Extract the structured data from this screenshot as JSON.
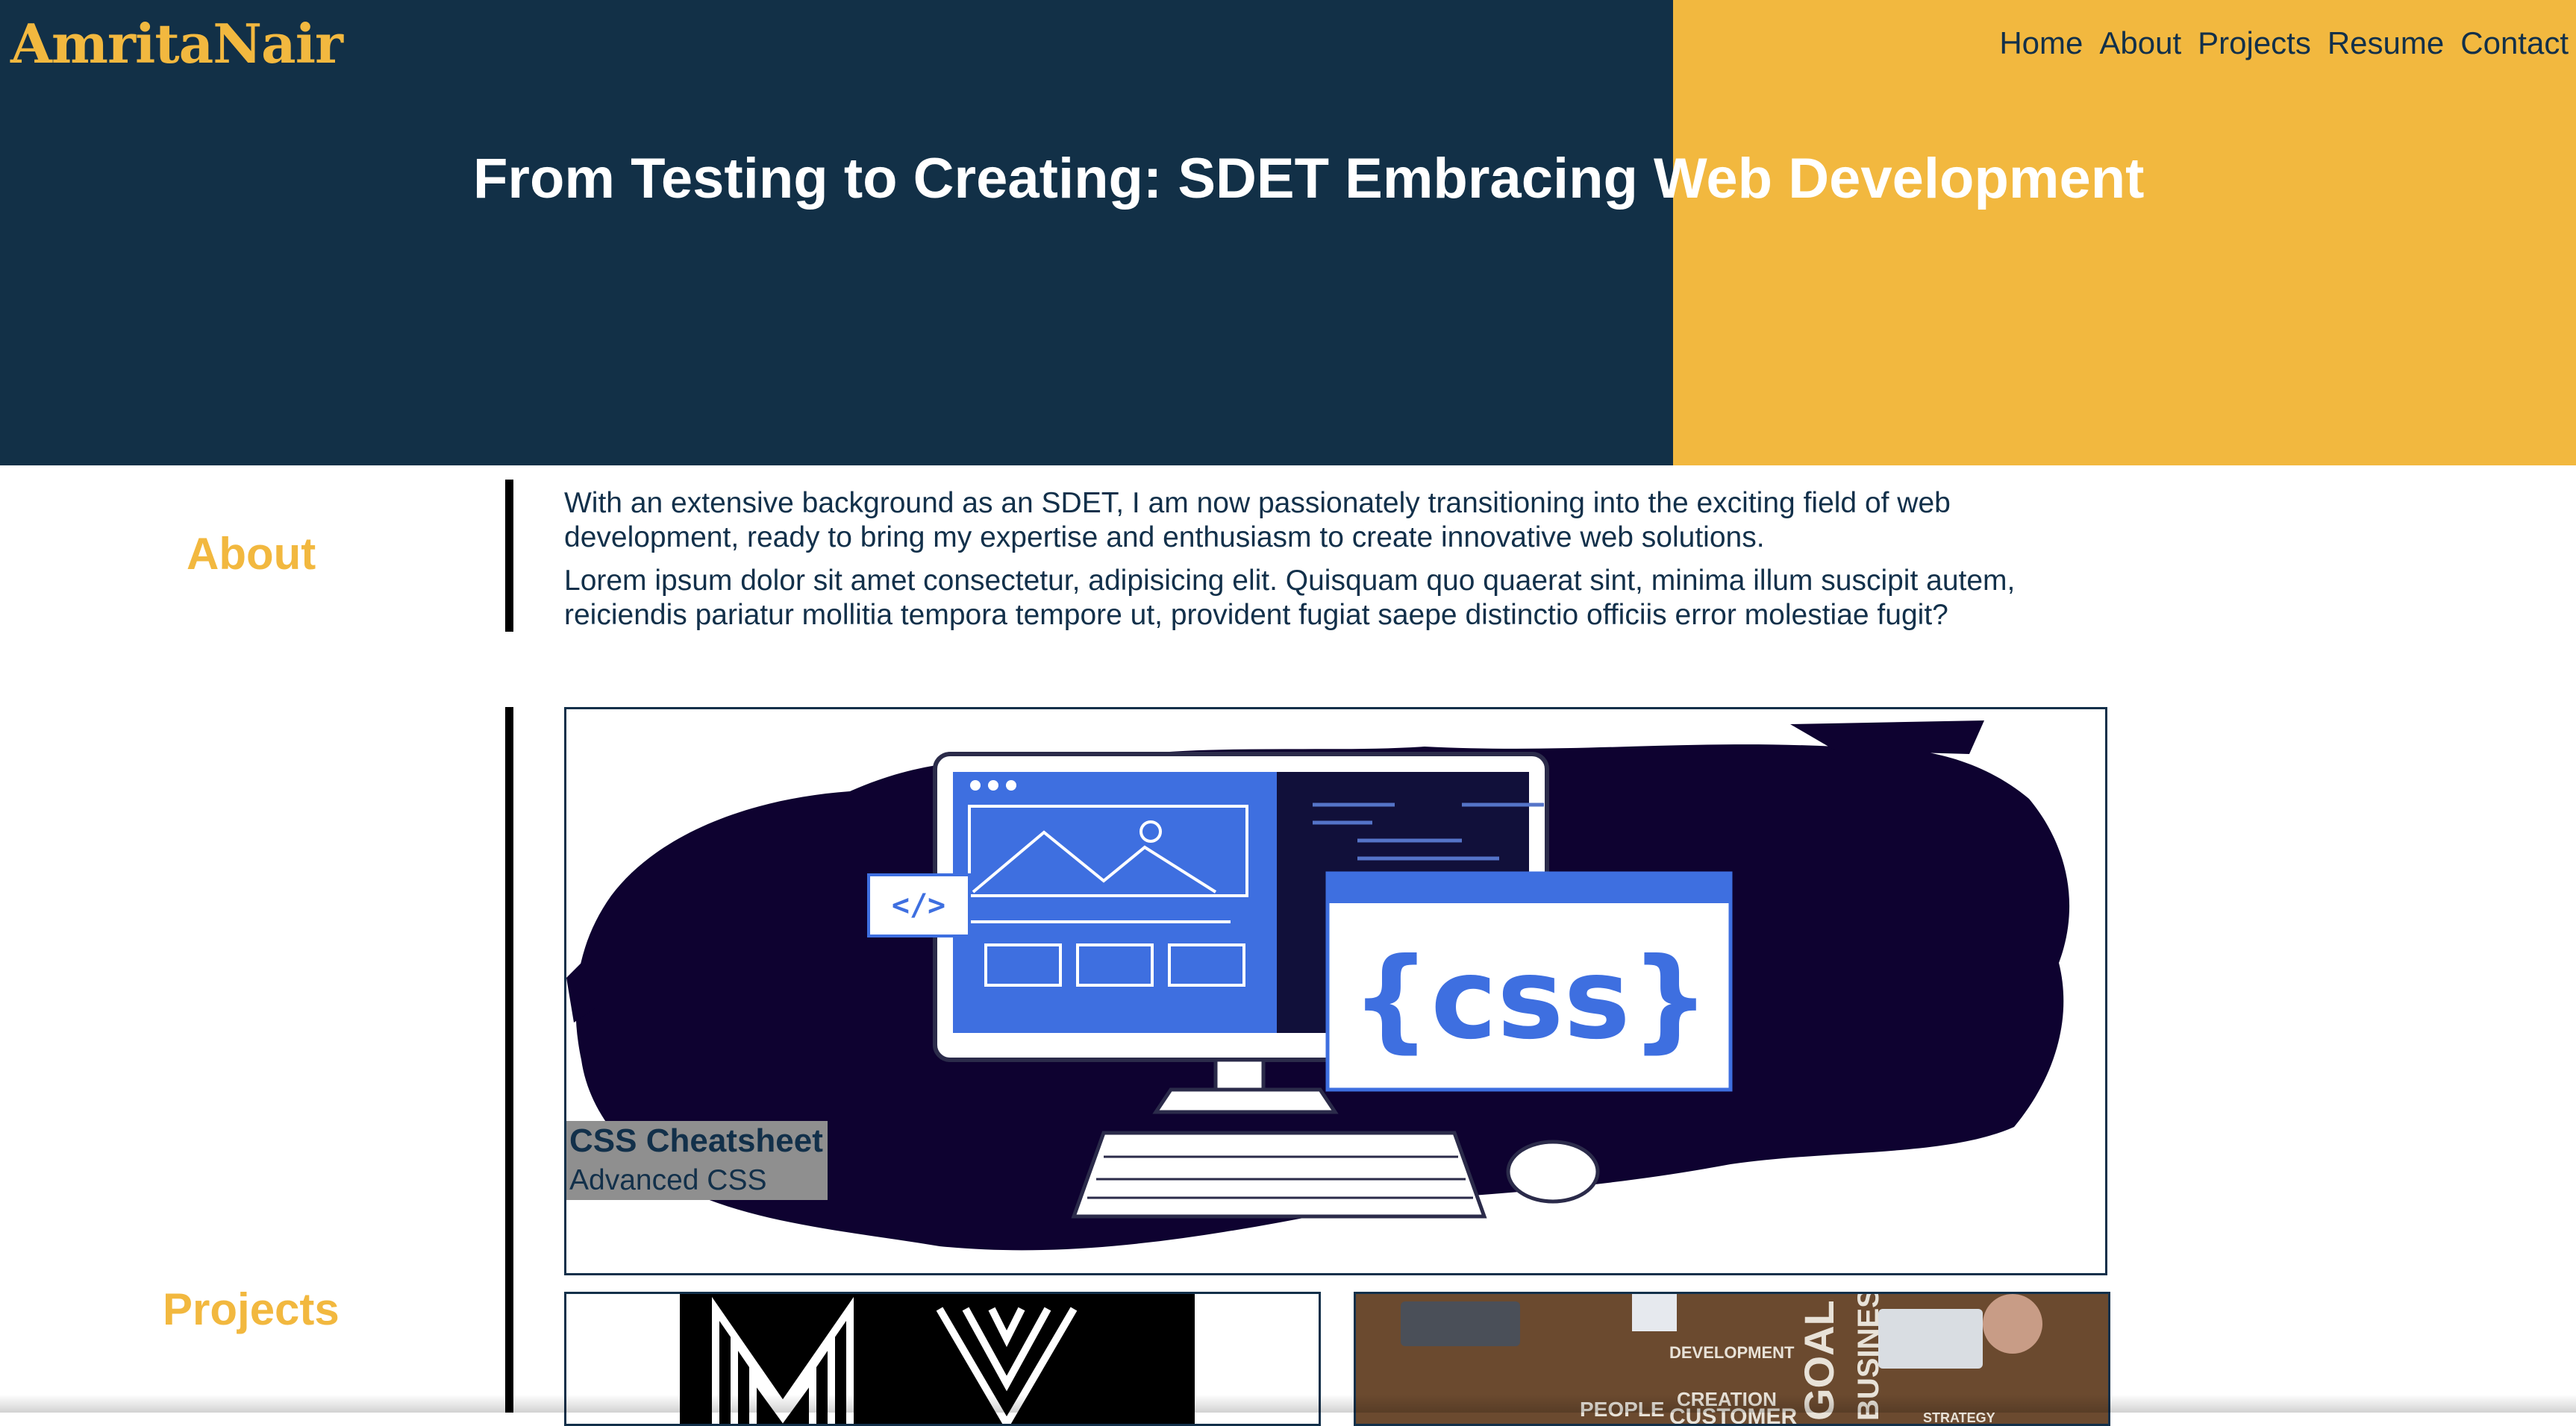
{
  "header": {
    "logo": "AmritaNair",
    "nav": [
      "Home",
      "About",
      "Projects",
      "Resume",
      "Contact"
    ],
    "title": "From Testing to Creating: SDET Embracing Web Development"
  },
  "about": {
    "label": "About",
    "paragraphs": [
      "With an extensive background as an SDET, I am now passionately transitioning into the exciting field of web development, ready to bring my expertise and enthusiasm to create innovative web solutions.",
      "Lorem ipsum dolor sit amet consectetur, adipisicing elit. Quisquam quo quaerat sint, minima illum suscipit autem, reiciendis pariatur mollitia tempora tempore ut, provident fugiat saepe distinctio officiis error molestiae fugit?"
    ]
  },
  "projects": {
    "label": "Projects",
    "featured": {
      "title": "CSS Cheatsheet",
      "subtitle": "Advanced CSS",
      "image_text": {
        "code_tag": "</>",
        "css_label": "{css}"
      }
    },
    "thumb_b_words": [
      "DEVELOPMENT",
      "GOAL",
      "BUSINESS",
      "PEOPLE",
      "CREATION",
      "CUSTOMER",
      "STRATEGY"
    ]
  },
  "colors": {
    "navy": "#123047",
    "accent": "#f2b83f",
    "blue": "#3e6fe0",
    "ink": "#0e0230"
  }
}
